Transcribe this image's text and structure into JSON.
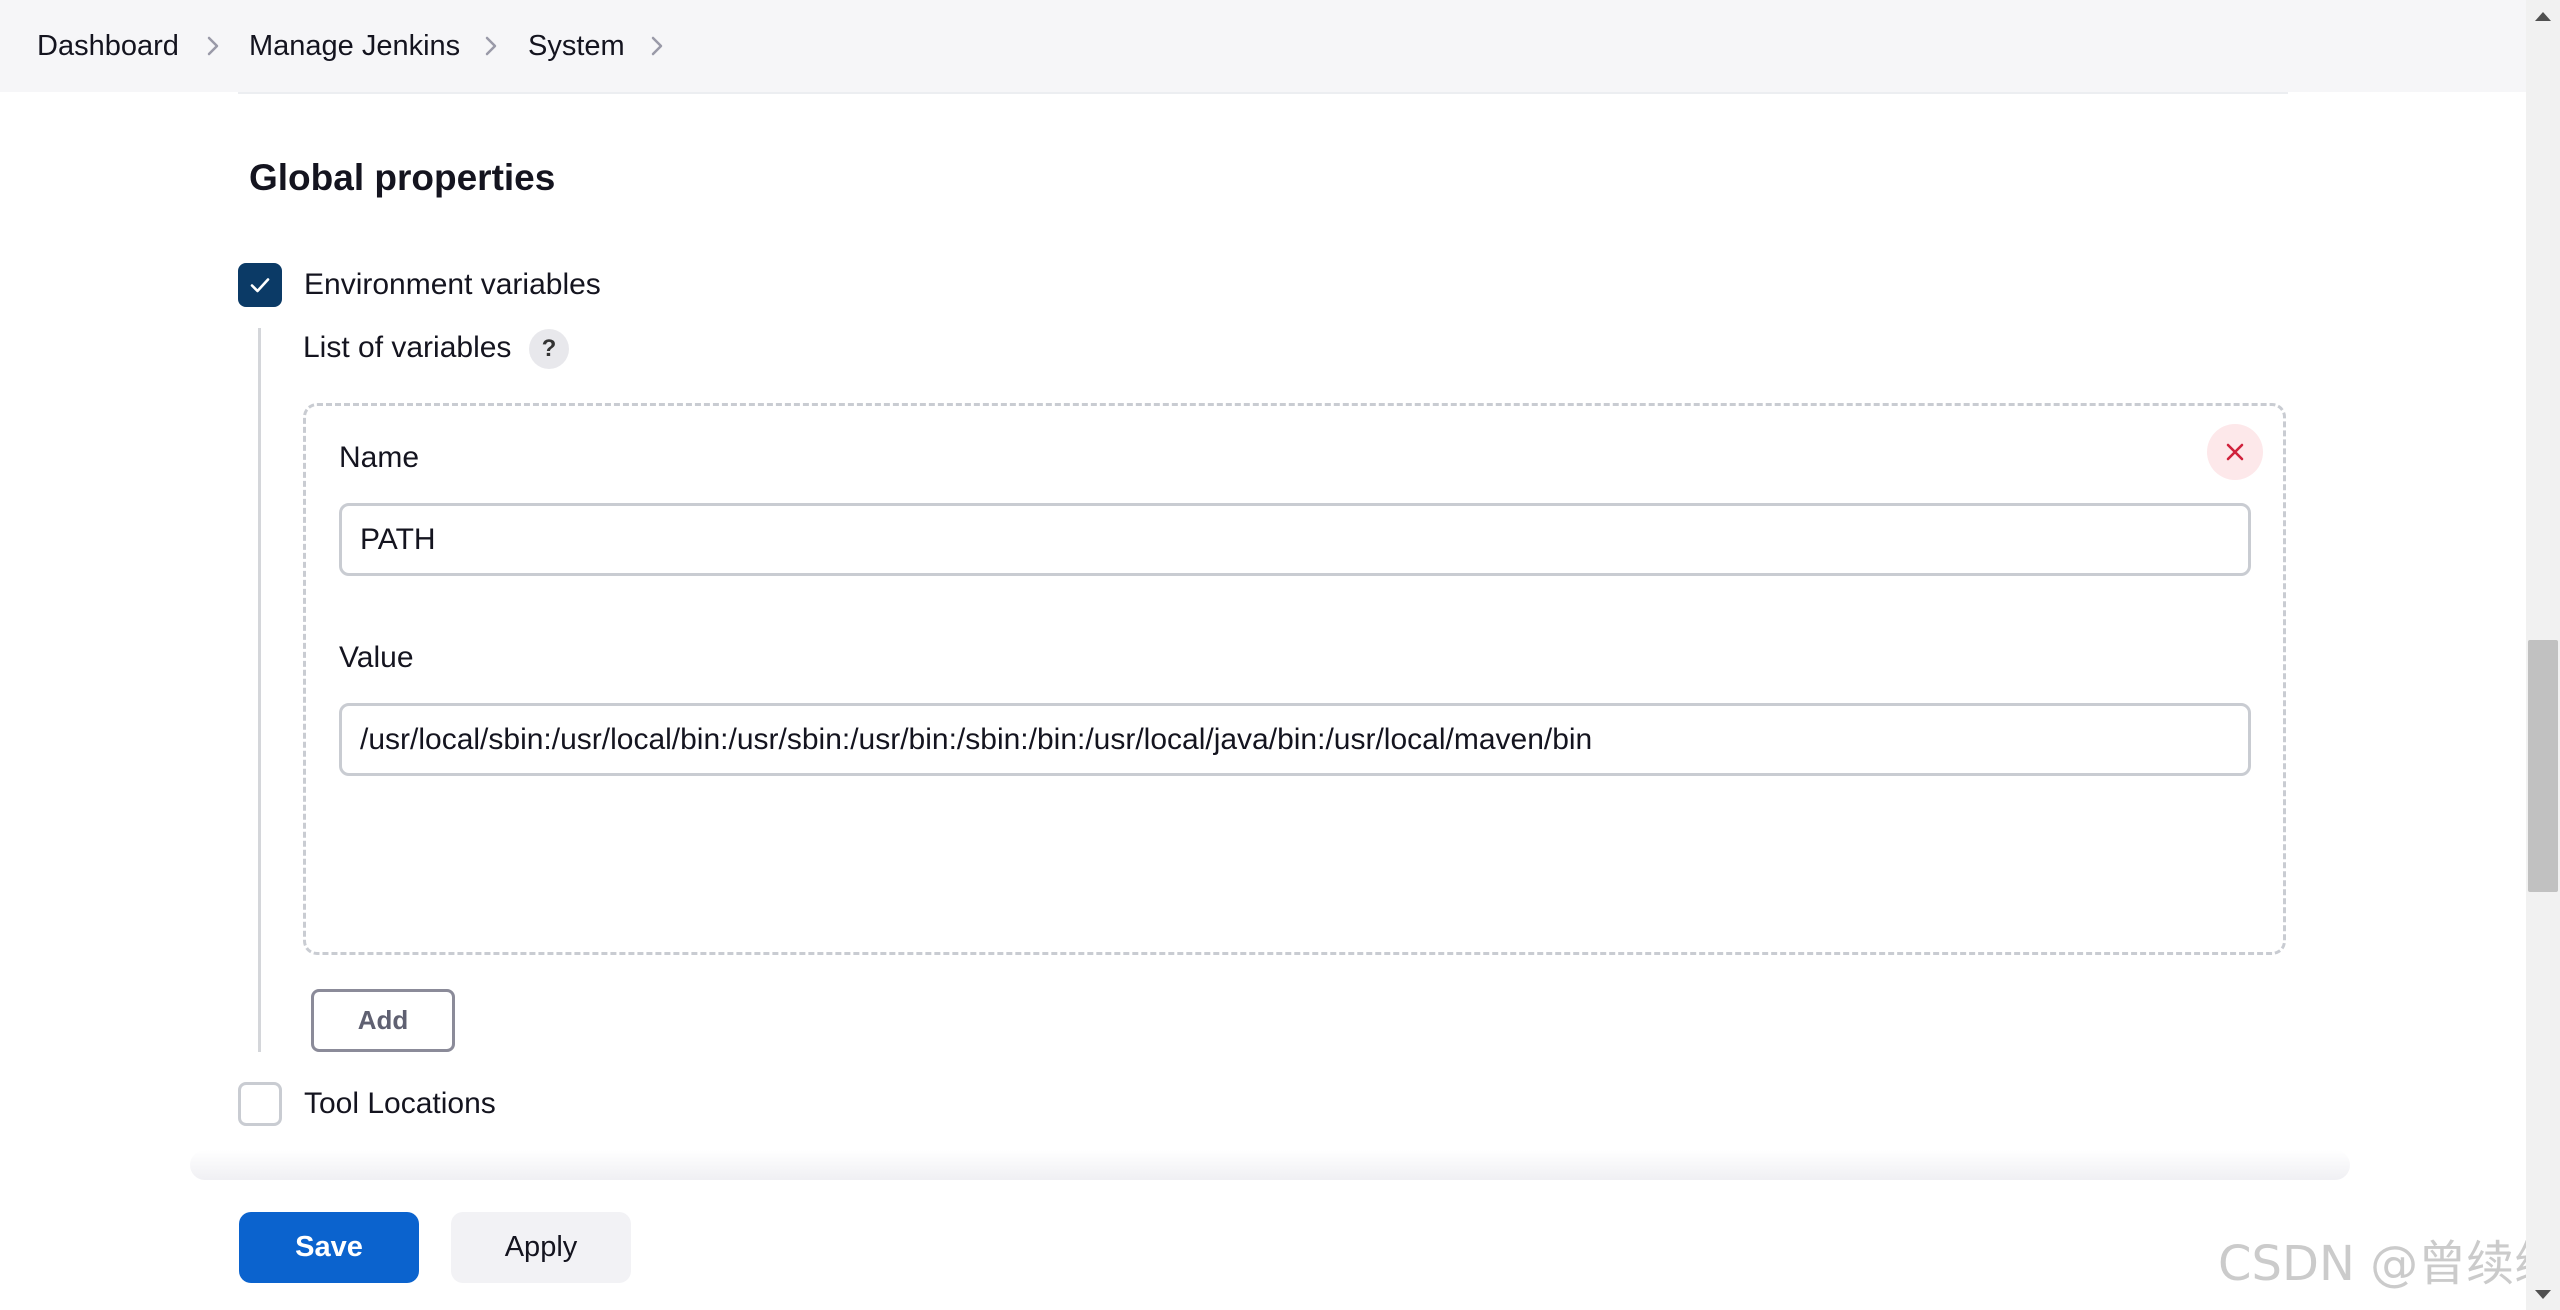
{
  "breadcrumb": {
    "items": [
      "Dashboard",
      "Manage Jenkins",
      "System"
    ]
  },
  "section": {
    "title": "Global properties"
  },
  "environment_variables": {
    "label": "Environment variables",
    "checked": true,
    "list_label": "List of variables",
    "help_symbol": "?",
    "variables": [
      {
        "name_label": "Name",
        "name_value": "PATH",
        "value_label": "Value",
        "value_value": "/usr/local/sbin:/usr/local/bin:/usr/sbin:/usr/bin:/sbin:/bin:/usr/local/java/bin:/usr/local/maven/bin"
      }
    ],
    "add_label": "Add"
  },
  "tool_locations": {
    "label": "Tool Locations",
    "checked": false
  },
  "actions": {
    "save_label": "Save",
    "apply_label": "Apply"
  },
  "watermark": "CSDN @曾续缘",
  "colors": {
    "primary": "#0b63ce",
    "checkbox_checked": "#0b3a66",
    "remove_icon": "#d0213b"
  },
  "icons": {
    "breadcrumb_separator": "chevron-right-icon",
    "checkbox": "check-icon",
    "remove": "close-icon",
    "help": "help-icon"
  }
}
